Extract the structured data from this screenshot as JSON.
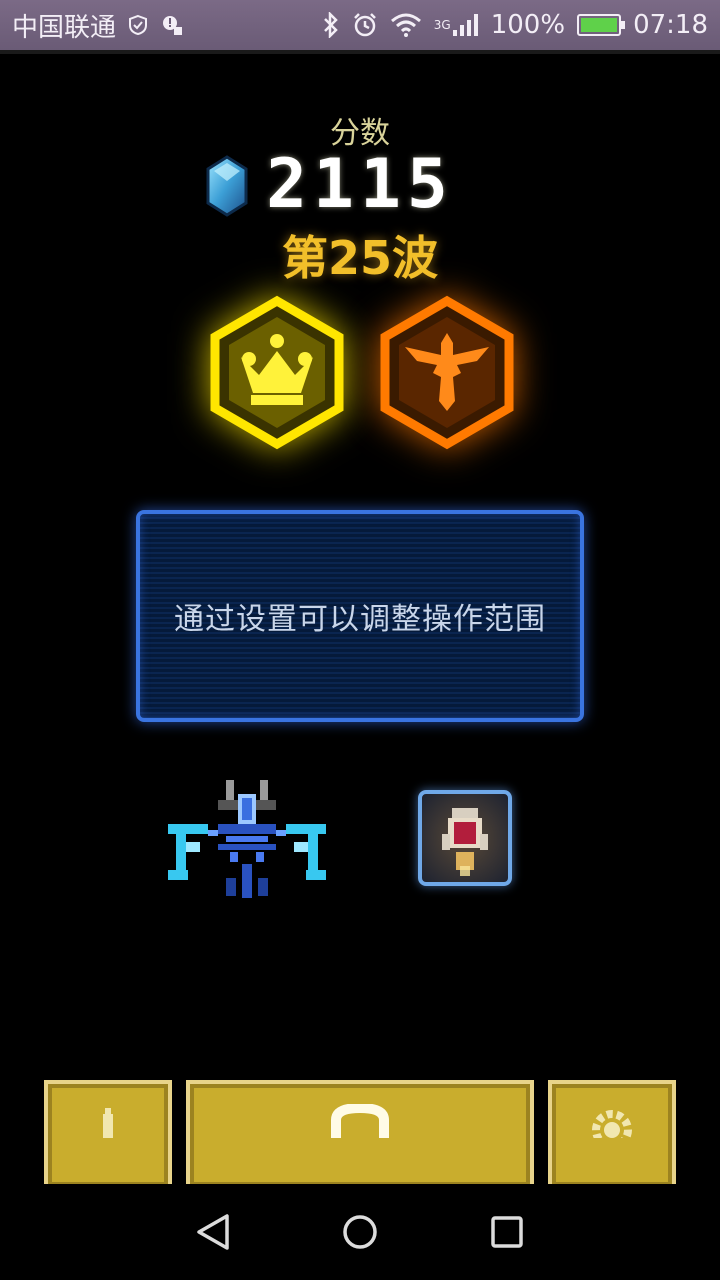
{
  "status_bar": {
    "carrier": "中国联通",
    "network": "3G",
    "battery": "100%",
    "time": "07:18",
    "icons": [
      "shield-icon",
      "notification-icon",
      "bluetooth-icon",
      "alarm-icon",
      "wifi-icon",
      "signal-icon",
      "battery-icon"
    ]
  },
  "hud": {
    "score_label": "分数",
    "score_value": "2115",
    "wave_label": "第25波"
  },
  "badges": [
    {
      "name": "crown-badge",
      "color": "#ffe600"
    },
    {
      "name": "eagle-badge",
      "color": "#ff7a00"
    }
  ],
  "tip": {
    "text": "通过设置可以调整操作范围"
  },
  "colors": {
    "panel_border": "#3a74e0",
    "button_gold": "#c9ad2d",
    "wave_text": "#f2bf2a"
  },
  "bottom_buttons": [
    "shop-button",
    "play-button",
    "settings-button"
  ],
  "nav": [
    "back-icon",
    "home-icon",
    "recents-icon"
  ]
}
